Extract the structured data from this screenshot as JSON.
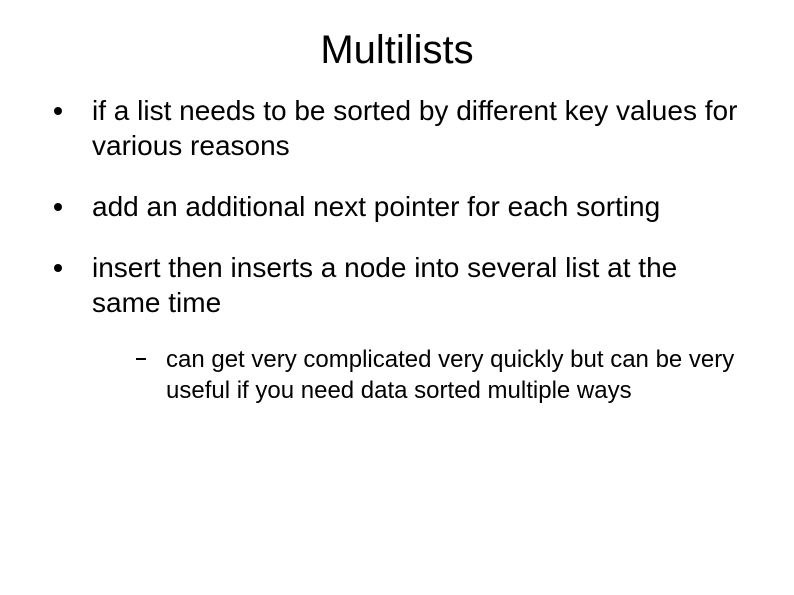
{
  "title": "Multilists",
  "bullets": [
    "if a list needs to be sorted by different key values for various reasons",
    "add an additional next pointer for each sorting",
    "insert then inserts a node into several list at the same time"
  ],
  "subbullets": [
    "can get very complicated very quickly but can  be very useful if you need data sorted multiple ways"
  ]
}
